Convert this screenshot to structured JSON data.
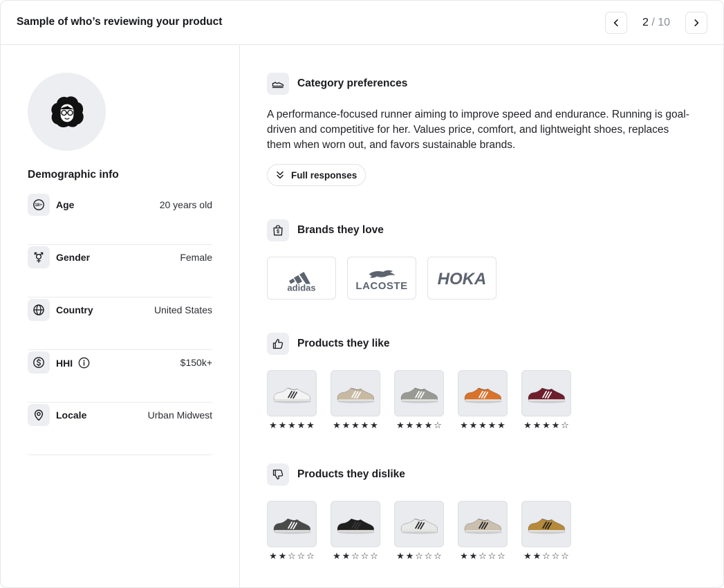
{
  "header": {
    "title": "Sample of who’s reviewing your product",
    "pager": {
      "current": "2",
      "separator": "/",
      "total": "10"
    }
  },
  "demographics": {
    "title": "Demographic info",
    "rows": [
      {
        "label": "Age",
        "value": "20 years old",
        "icon": "age-18-plus-icon"
      },
      {
        "label": "Gender",
        "value": "Female",
        "icon": "gender-icon"
      },
      {
        "label": "Country",
        "value": "United States",
        "icon": "globe-icon"
      },
      {
        "label": "HHI",
        "value": "$150k+",
        "icon": "dollar-icon"
      },
      {
        "label": "Locale",
        "value": "Urban Midwest",
        "icon": "map-pin-icon"
      }
    ]
  },
  "category": {
    "title": "Category preferences",
    "description": "A performance-focused runner aiming to improve speed and endurance. Running is goal-driven and competitive for her. Values price, comfort, and lightweight shoes, replaces them when worn out, and favors sustainable brands.",
    "full_responses_label": "Full responses"
  },
  "brands": {
    "title": "Brands they love",
    "items": [
      "adidas",
      "LACOSTE",
      "HOKA"
    ]
  },
  "liked": {
    "title": "Products they like",
    "items": [
      {
        "rating": 5,
        "shoe_color": "#f4f4f4",
        "accent": "#2c2c2c"
      },
      {
        "rating": 5,
        "shoe_color": "#c8b9a2",
        "accent": "#ffffff"
      },
      {
        "rating": 4,
        "shoe_color": "#9a9a94",
        "accent": "#ffffff"
      },
      {
        "rating": 5,
        "shoe_color": "#d9722a",
        "accent": "#ffffff"
      },
      {
        "rating": 4,
        "shoe_color": "#6e1f2e",
        "accent": "#ffffff"
      }
    ]
  },
  "disliked": {
    "title": "Products they dislike",
    "items": [
      {
        "rating": 2,
        "shoe_color": "#4a4a4a",
        "accent": "#ffffff"
      },
      {
        "rating": 2,
        "shoe_color": "#1f1f1f",
        "accent": "#3a3a3a"
      },
      {
        "rating": 2,
        "shoe_color": "#e8e8e8",
        "accent": "#1f1f1f"
      },
      {
        "rating": 2,
        "shoe_color": "#cbbfae",
        "accent": "#1f1f1f"
      },
      {
        "rating": 2,
        "shoe_color": "#b58a3a",
        "accent": "#1f1f1f"
      }
    ]
  },
  "colors": {
    "border": "#e4e6ea",
    "icon_bg": "#eceef1",
    "text": "#1a1b1f",
    "muted": "#8a8f98"
  }
}
